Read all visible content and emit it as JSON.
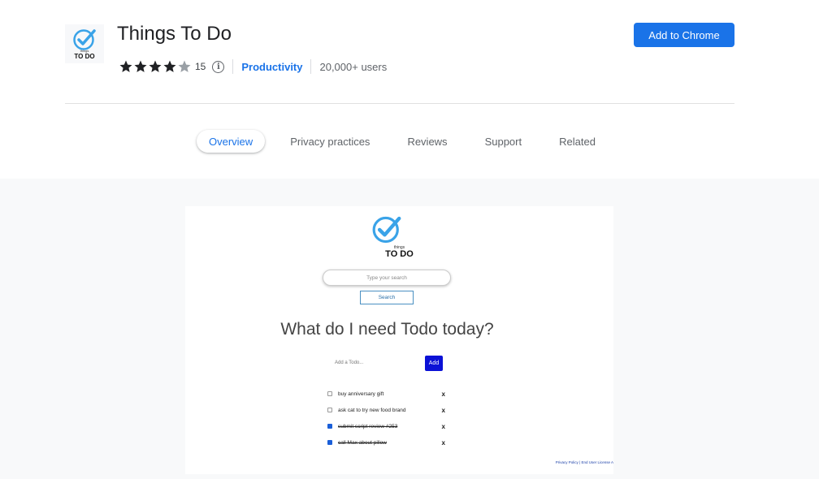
{
  "extension": {
    "icon_name": "things-to-do-logo-icon",
    "icon_text_small": "things",
    "icon_text_big": "TO DO",
    "title": "Things To Do",
    "rating": 4.0,
    "rating_count": "15",
    "category": "Productivity",
    "users": "20,000+ users",
    "add_button": "Add to Chrome"
  },
  "tabs": [
    {
      "label": "Overview",
      "active": true
    },
    {
      "label": "Privacy practices",
      "active": false
    },
    {
      "label": "Reviews",
      "active": false
    },
    {
      "label": "Support",
      "active": false
    },
    {
      "label": "Related",
      "active": false
    }
  ],
  "screenshot": {
    "logo_small": "things",
    "logo_big": "TO DO",
    "search_placeholder": "Type your search",
    "search_button": "Search",
    "heading": "What do I need Todo today?",
    "add_placeholder": "Add a Todo...",
    "add_button": "Add",
    "todos": [
      {
        "text": "buy anniversary gift",
        "done": false,
        "remove": "x"
      },
      {
        "text": "ask cat to try new food brand",
        "done": false,
        "remove": "x"
      },
      {
        "text": "submit script review #253",
        "done": true,
        "remove": "x"
      },
      {
        "text": "call Max about pillow",
        "done": true,
        "remove": "x"
      }
    ],
    "footer": "Privacy Policy | End User License A"
  },
  "colors": {
    "accent": "#1a73e8",
    "add_button_bg": "#0b11d6",
    "gallery_bg": "#f8f9fa"
  }
}
